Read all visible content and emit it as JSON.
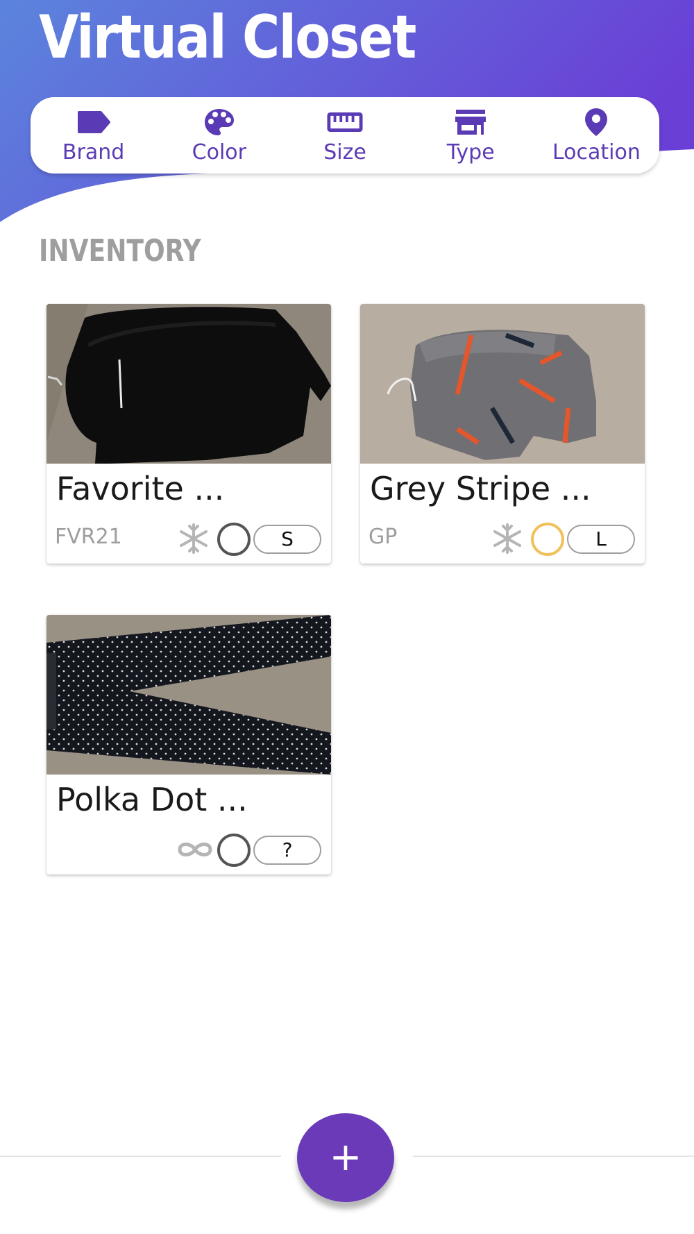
{
  "app": {
    "title": "Virtual Closet"
  },
  "colors": {
    "accent": "#5b3bb5",
    "gradient_start": "#5b84dd",
    "gradient_end": "#6a3fd6",
    "fab": "#6a3ab8"
  },
  "filters": [
    {
      "label": "Brand",
      "icon": "tag-icon"
    },
    {
      "label": "Color",
      "icon": "palette-icon"
    },
    {
      "label": "Size",
      "icon": "ruler-icon"
    },
    {
      "label": "Type",
      "icon": "store-icon"
    },
    {
      "label": "Location",
      "icon": "location-pin-icon"
    }
  ],
  "inventory": {
    "title": "INVENTORY",
    "items": [
      {
        "name": "Favorite ...",
        "brand": "FVR21",
        "season_icon": "snowflake-icon",
        "color_swatch": "#555555",
        "size": "S"
      },
      {
        "name": "Grey Stripe ...",
        "brand": "GP",
        "season_icon": "snowflake-icon",
        "color_swatch": "#f0c15a",
        "size": "L"
      },
      {
        "name": "Polka Dot ...",
        "brand": "",
        "season_icon": "infinity-icon",
        "color_swatch": "#555555",
        "size": "?"
      }
    ]
  },
  "fab": {
    "icon": "plus-icon",
    "symbol": "+"
  }
}
